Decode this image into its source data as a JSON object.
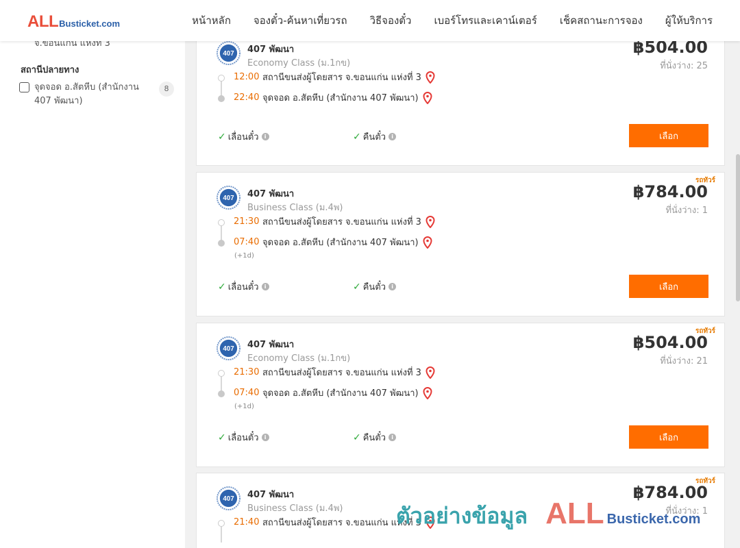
{
  "brand": {
    "logo_main": "ALL",
    "logo_rest": "Busticket.com"
  },
  "nav": [
    {
      "label": "หน้าหลัก"
    },
    {
      "label": "จองตั๋ว-ค้นหาเที่ยวรถ"
    },
    {
      "label": "วิธีจองตั๋ว"
    },
    {
      "label": "เบอร์โทรและเคาน์เตอร์"
    },
    {
      "label": "เช็คสถานะการจอง"
    },
    {
      "label": "ผู้ให้บริการ"
    }
  ],
  "sidebar": {
    "prev_text": "จ.ขอนแก่น แห่งที่ 3",
    "destination_title": "สถานีปลายทาง",
    "destination_option": {
      "label": "จุดจอด อ.สัตหีบ (สำนักงาน 407 พัฒนา)",
      "count": "8",
      "checked": false
    }
  },
  "trips": [
    {
      "hot": "",
      "operator": "407 พัฒนา",
      "class": "Economy Class (ม.1กข)",
      "price": "฿504.00",
      "seats": "ที่นั่งว่าง: 25",
      "depart_time": "12:00",
      "depart_station": "สถานีขนส่งผู้โดยสาร จ.ขอนแก่น แห่งที่ 3",
      "arrive_time": "22:40",
      "arrive_station": "จุดจอด อ.สัตหีบ (สำนักงาน 407 พัฒนา)",
      "next_day": "",
      "feature1": "เลื่อนตั๋ว",
      "feature2": "คืนตั๋ว",
      "select_label": "เลือก"
    },
    {
      "hot": "รถทัวร์",
      "operator": "407 พัฒนา",
      "class": "Business Class (ม.4พ)",
      "price": "฿784.00",
      "seats": "ที่นั่งว่าง: 1",
      "depart_time": "21:30",
      "depart_station": "สถานีขนส่งผู้โดยสาร จ.ขอนแก่น แห่งที่ 3",
      "arrive_time": "07:40",
      "arrive_station": "จุดจอด อ.สัตหีบ (สำนักงาน 407 พัฒนา)",
      "next_day": "(+1d)",
      "feature1": "เลื่อนตั๋ว",
      "feature2": "คืนตั๋ว",
      "select_label": "เลือก"
    },
    {
      "hot": "รถทัวร์",
      "operator": "407 พัฒนา",
      "class": "Economy Class (ม.1กข)",
      "price": "฿504.00",
      "seats": "ที่นั่งว่าง: 21",
      "depart_time": "21:30",
      "depart_station": "สถานีขนส่งผู้โดยสาร จ.ขอนแก่น แห่งที่ 3",
      "arrive_time": "07:40",
      "arrive_station": "จุดจอด อ.สัตหีบ (สำนักงาน 407 พัฒนา)",
      "next_day": "(+1d)",
      "feature1": "เลื่อนตั๋ว",
      "feature2": "คืนตั๋ว",
      "select_label": "เลือก"
    },
    {
      "hot": "รถทัวร์",
      "operator": "407 พัฒนา",
      "class": "Business Class (ม.4พ)",
      "price": "฿784.00",
      "seats": "ที่นั่งว่าง: 1",
      "depart_time": "21:40",
      "depart_station": "สถานีขนส่งผู้โดยสาร จ.ขอนแก่น แห่งที่ 3",
      "arrive_time": "",
      "arrive_station": "",
      "next_day": "",
      "feature1": "",
      "feature2": "",
      "select_label": ""
    }
  ],
  "watermark": {
    "thai": "ตัวอย่างข้อมูล",
    "main": "ALL",
    "rest": "Busticket.com"
  },
  "colors": {
    "accent": "#ff6d00",
    "time": "#e96c00",
    "brand_red": "#e94e3a",
    "brand_blue": "#2a5fa8",
    "check": "#2eaa3a"
  }
}
